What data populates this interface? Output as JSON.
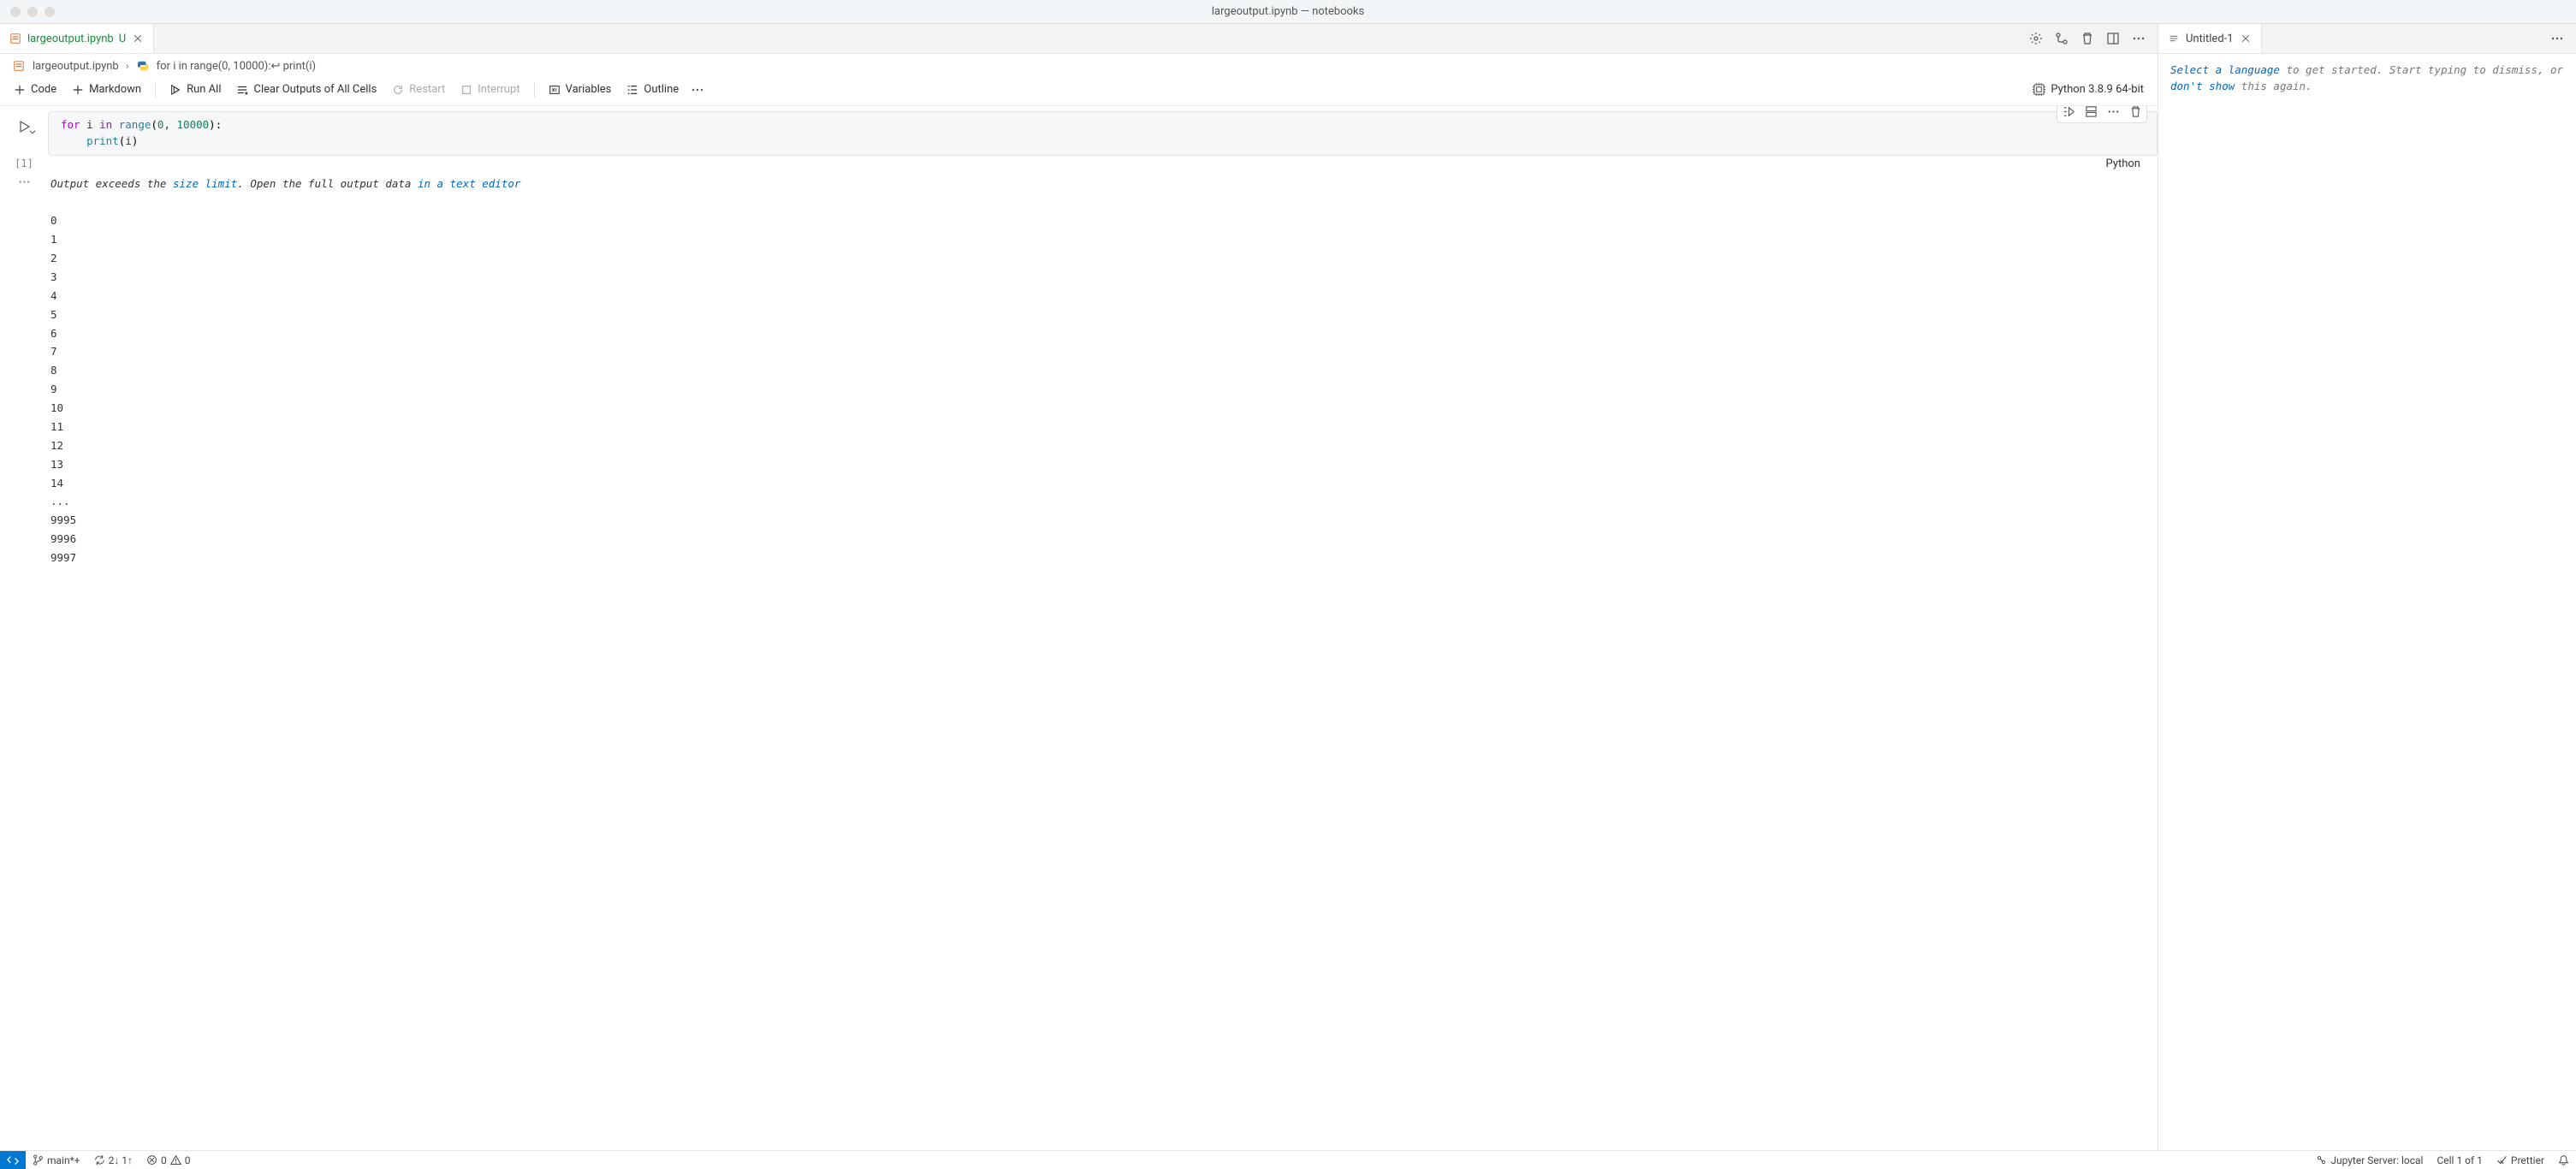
{
  "window": {
    "title": "largeoutput.ipynb — notebooks"
  },
  "leftTabs": {
    "tab1": {
      "label": "largeoutput.ipynb",
      "dirty": "U"
    }
  },
  "rightTabs": {
    "tab1": {
      "label": "Untitled-1"
    }
  },
  "breadcrumb": {
    "s1": "largeoutput.ipynb",
    "s2": "for i in range(0, 10000):↩    print(i)"
  },
  "toolbar": {
    "code": "Code",
    "markdown": "Markdown",
    "runAll": "Run All",
    "clearOutputs": "Clear Outputs of All Cells",
    "restart": "Restart",
    "interrupt": "Interrupt",
    "variables": "Variables",
    "outline": "Outline",
    "kernel": "Python 3.8.9 64-bit"
  },
  "cell": {
    "execCount": "[1]",
    "lang": "Python",
    "code": {
      "l1_for": "for",
      "l1_i": " i ",
      "l1_in": "in",
      "l1_sp": " ",
      "l1_range": "range",
      "l1_p1": "(",
      "l1_n0": "0",
      "l1_comma": ", ",
      "l1_n1": "10000",
      "l1_p2": ")",
      "l1_colon": ":",
      "l2_indent": "    ",
      "l2_print": "print",
      "l2_p1": "(",
      "l2_i": "i",
      "l2_p2": ")"
    }
  },
  "output": {
    "warn1": "Output exceeds the ",
    "warnLink1": "size limit",
    "warn2": ". Open the full output data ",
    "warnLink2": "in a text editor",
    "lines": [
      "0",
      "1",
      "2",
      "3",
      "4",
      "5",
      "6",
      "7",
      "8",
      "9",
      "10",
      "11",
      "12",
      "13",
      "14",
      "...",
      "9995",
      "9996",
      "9997"
    ]
  },
  "rightPane": {
    "t1": "Select a language",
    "t2": " to get started. Start typing to dismiss, or ",
    "t3": "don't show",
    "t4": " this again."
  },
  "status": {
    "branch": "main*+",
    "sync": "2↓ 1↑",
    "errors": "0",
    "warnings": "0",
    "jupyter": "Jupyter Server: local",
    "cell": "Cell 1 of 1",
    "prettier": "Prettier"
  }
}
